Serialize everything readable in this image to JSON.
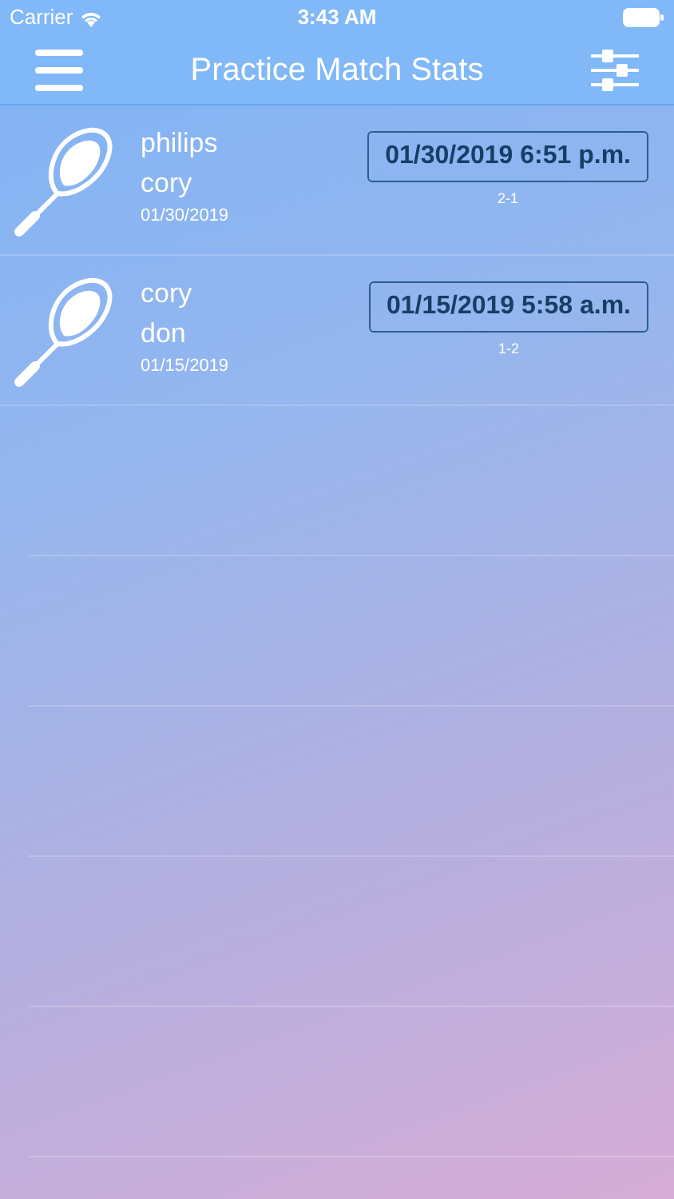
{
  "status_bar": {
    "carrier": "Carrier",
    "time": "3:43 AM"
  },
  "nav_bar": {
    "title": "Practice Match Stats"
  },
  "matches": [
    {
      "player_1": "philips",
      "player_2": "cory",
      "date": "01/30/2019",
      "datetime": "01/30/2019 6:51 p.m.",
      "score": "2-1"
    },
    {
      "player_1": "cory",
      "player_2": "don",
      "date": "01/15/2019",
      "datetime": "01/15/2019 5:58 a.m.",
      "score": "1-2"
    }
  ]
}
